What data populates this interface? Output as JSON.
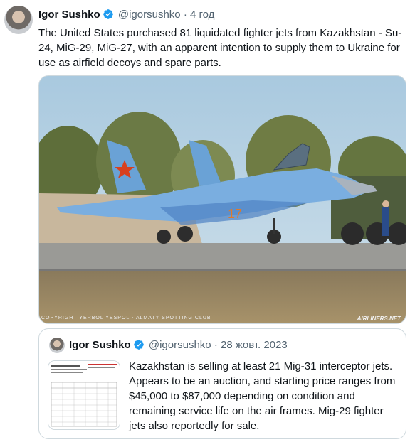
{
  "tweet": {
    "author_name": "Igor Sushko",
    "handle": "@igorsushko",
    "separator": "·",
    "time": "4 год",
    "text": "The United States purchased 81 liquidated fighter jets from Kazakhstan - Su-24, MiG-29, MiG-27, with an apparent intention to supply them to Ukraine for use as airfield decoys and spare parts.",
    "media": {
      "copyright": "COPYRIGHT YERBOL YESPOL - ALMATY SPOTTING CLUB",
      "watermark": "AIRLINERS.NET",
      "tail_number": "17"
    }
  },
  "quoted_tweet": {
    "author_name": "Igor Sushko",
    "handle": "@igorsushko",
    "separator": "·",
    "time": "28 жовт. 2023",
    "text": "Kazakhstan is selling at least 21 Mig-31 interceptor jets. Appears to be an auction, and starting price ranges from $45,000 to $87,000 depending on condition and remaining service life on the air frames. Mig-29 fighter jets also reportedly for sale."
  },
  "colors": {
    "verified": "#1d9bf0",
    "secondary_text": "#536471",
    "border": "#cfd9de"
  },
  "icons": [
    "verified-badge-icon",
    "avatar"
  ]
}
